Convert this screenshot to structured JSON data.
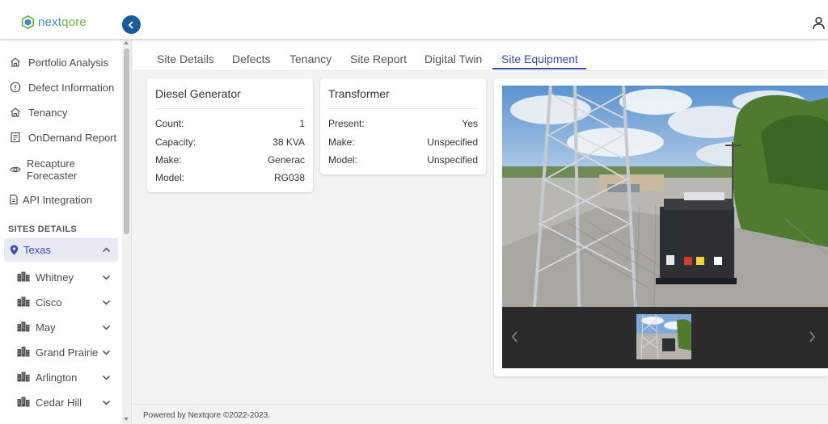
{
  "brand": {
    "name_part1": "next",
    "name_part2": "qore"
  },
  "sidebar": {
    "items": [
      {
        "label": "Portfolio Analysis",
        "icon": "home-icon"
      },
      {
        "label": "Defect Information",
        "icon": "info-circle-icon"
      },
      {
        "label": "Tenancy",
        "icon": "home-icon"
      },
      {
        "label": "OnDemand Report",
        "icon": "report-icon"
      },
      {
        "label": "Recapture Forecaster",
        "icon": "eye-icon"
      },
      {
        "label": "API Integration",
        "icon": "document-icon"
      }
    ],
    "section_title": "SITES DETAILS",
    "state": {
      "label": "Texas",
      "expanded": true
    },
    "sites": [
      "Whitney",
      "Cisco",
      "May",
      "Grand Prairie",
      "Arlington",
      "Cedar Hill"
    ]
  },
  "tabs": [
    {
      "label": "Site Details",
      "active": false
    },
    {
      "label": "Defects",
      "active": false
    },
    {
      "label": "Tenancy",
      "active": false
    },
    {
      "label": "Site Report",
      "active": false
    },
    {
      "label": "Digital Twin",
      "active": false
    },
    {
      "label": "Site Equipment",
      "active": true
    }
  ],
  "generator": {
    "title": "Diesel Generator",
    "rows": [
      {
        "key": "Count:",
        "value": "1"
      },
      {
        "key": "Capacity:",
        "value": "38 KVA"
      },
      {
        "key": "Make:",
        "value": "Generac"
      },
      {
        "key": "Model:",
        "value": "RG038"
      }
    ]
  },
  "transformer": {
    "title": "Transformer",
    "rows": [
      {
        "key": "Present:",
        "value": "Yes"
      },
      {
        "key": "Make:",
        "value": "Unspecified"
      },
      {
        "key": "Model:",
        "value": "Unspecified"
      }
    ]
  },
  "footer": {
    "text": "Powered by Nextqore ©2022-2023."
  },
  "colors": {
    "accent": "#3b4aa8",
    "header_button": "#1a5a99",
    "active_bg": "#e7eaf4"
  }
}
